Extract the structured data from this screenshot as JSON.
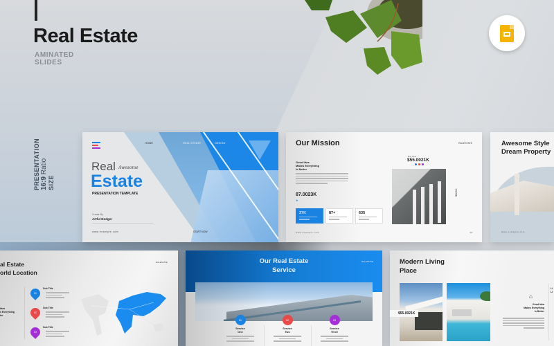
{
  "hero": {
    "title": "Real Estate",
    "subtitle_line1": "AMINATED",
    "subtitle_line2": "SLIDES",
    "badge_icon": "google-slides-icon",
    "ratio_line1": "PRESENTATION",
    "ratio_value": "16:9",
    "ratio_word": "Ratio",
    "ratio_size": "SIZE"
  },
  "colors": {
    "accent_blue": "#1a82e0",
    "red": "#e84a4a",
    "purple": "#a52fd6",
    "google_slides_yellow": "#f5b400"
  },
  "slides": {
    "cover": {
      "nav": [
        "HOME",
        "REAL ESTATE",
        "DESIGN"
      ],
      "title_thin": "Real",
      "script_word": "Awesome",
      "title_bold": "Estate",
      "tagline": "PRESENTATION TEMPLATE",
      "created_by_label": "Create By",
      "author": "Artful Dodger",
      "url": "www.example.com",
      "cta": "START NOW"
    },
    "mission": {
      "title": "Our Mission",
      "tag": "RALESTATE",
      "good_idea": [
        "Good Idea",
        "Makes Everything",
        "Is Better"
      ],
      "stat_big": "87.0023K",
      "buy_now": "Buy Now",
      "price": "$55.0021K",
      "vertical_label": "HOME",
      "cards": [
        {
          "value": "37K",
          "highlight": true
        },
        {
          "value": "87+",
          "highlight": false
        },
        {
          "value": "635",
          "highlight": false
        }
      ],
      "url": "www.example.com",
      "page": "04"
    },
    "awesome": {
      "title_line1": "Awesome Style",
      "title_line2": "Dream Property",
      "url": "www.example.com"
    },
    "location": {
      "title_line1": "al Estate",
      "title_line2": "orld Location",
      "tag": "RALESTATE",
      "good_idea": [
        "Idea",
        "s Everything",
        "ter"
      ],
      "items": [
        {
          "num": "01",
          "title": "Sub Title",
          "color": "#1a82e0"
        },
        {
          "num": "02",
          "title": "Sub Title",
          "color": "#e84a4a"
        },
        {
          "num": "03",
          "title": "Sub Title",
          "color": "#a52fd6"
        }
      ]
    },
    "service": {
      "title_line1": "Our Real Estate",
      "title_line2": "Service",
      "tag": "RALESTATE",
      "items": [
        {
          "num": "01",
          "name_line1": "Service",
          "name_line2": "One",
          "color": "#1a82e0"
        },
        {
          "num": "02",
          "name_line1": "Service",
          "name_line2": "Two",
          "color": "#e84a4a"
        },
        {
          "num": "03",
          "name_line1": "Service",
          "name_line2": "Three",
          "color": "#a52fd6"
        }
      ]
    },
    "modern": {
      "title_line1": "Modern Living",
      "title_line2": "Place",
      "price": "$55.0021K",
      "good_idea": [
        "Good Idea",
        "Makes Everything",
        "Is Better"
      ],
      "side_heading_line1": "Li",
      "side_heading_line2": "Li"
    }
  }
}
